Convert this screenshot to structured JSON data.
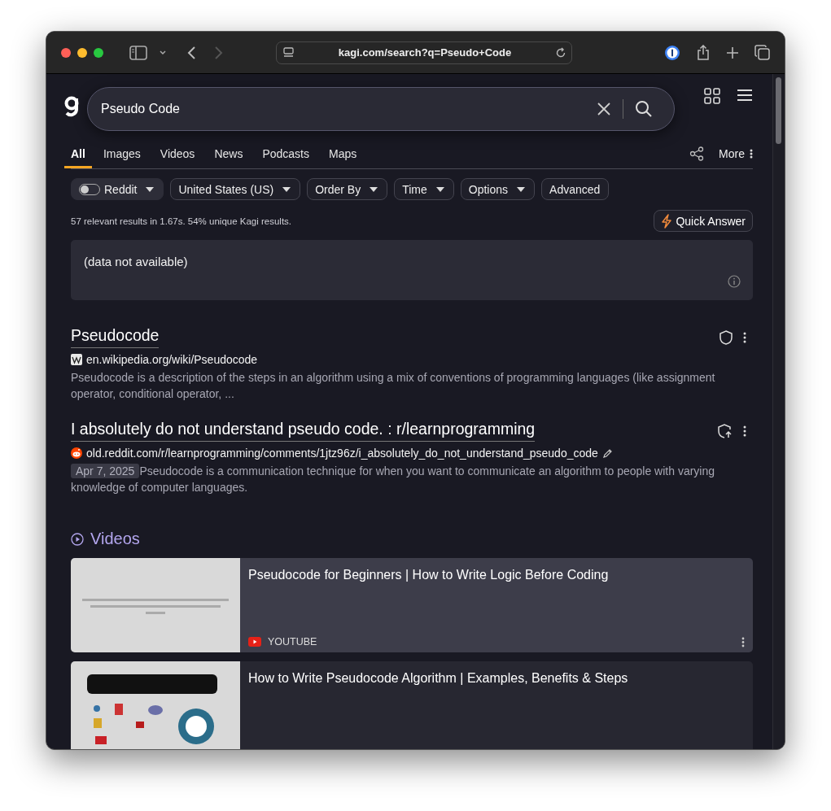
{
  "browser": {
    "url": "kagi.com/search?q=Pseudo+Code"
  },
  "search": {
    "value": "Pseudo Code"
  },
  "tabs": [
    {
      "label": "All",
      "selected": true
    },
    {
      "label": "Images",
      "selected": false
    },
    {
      "label": "Videos",
      "selected": false
    },
    {
      "label": "News",
      "selected": false
    },
    {
      "label": "Podcasts",
      "selected": false
    },
    {
      "label": "Maps",
      "selected": false
    }
  ],
  "more": "More",
  "filters": [
    {
      "kind": "toggle",
      "label": "Reddit",
      "on": false
    },
    {
      "kind": "dropdown",
      "label": "United States (US)"
    },
    {
      "kind": "dropdown",
      "label": "Order By"
    },
    {
      "kind": "dropdown",
      "label": "Time"
    },
    {
      "kind": "dropdown",
      "label": "Options"
    },
    {
      "kind": "button",
      "label": "Advanced"
    }
  ],
  "stats": "57 relevant results in 1.67s. 54% unique Kagi results.",
  "quick_answer": "Quick Answer",
  "answer_box": {
    "text": "(data not available)"
  },
  "results": [
    {
      "kind": "wiki",
      "title": "Pseudocode",
      "url": "en.wikipedia.org/wiki/Pseudocode",
      "editable": false,
      "snippet": "Pseudocode is a description of the steps in an algorithm using a mix of conventions of programming languages (like assignment operator, conditional operator, ..."
    },
    {
      "kind": "forum",
      "title": "I absolutely do not understand pseudo code. : r/learnprogramming",
      "url": "old.reddit.com/r/learnprogramming/comments/1jtz96z/i_absolutely_do_not_understand_pseudo_code",
      "editable": true,
      "date": "Apr 7, 2025",
      "snippet": "Pseudocode is a communication technique for when you want to communicate an algorithm to people with varying knowledge of computer languages."
    }
  ],
  "videos": {
    "heading": "Videos",
    "items": [
      {
        "title": "Pseudocode for Beginners | How to Write Logic Before Coding",
        "source": "YOUTUBE",
        "hovered": true
      },
      {
        "title": "How to Write Pseudocode Algorithm | Examples, Benefits & Steps",
        "hovered": false
      }
    ]
  }
}
